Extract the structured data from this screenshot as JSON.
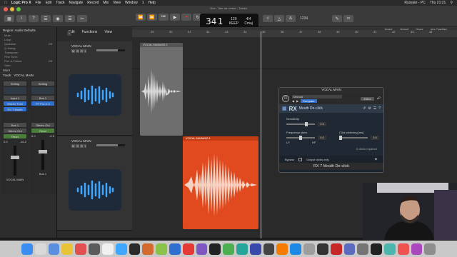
{
  "menubar": {
    "app_name": "Logic Pro X",
    "items": [
      "File",
      "Edit",
      "Track",
      "Navigate",
      "Record",
      "Mix",
      "View",
      "Window",
      "1",
      "Help"
    ],
    "clock": "Thu 21:21",
    "locale": "Russian - PC"
  },
  "window_title": "One - Tate ran verse - Tracks",
  "lcd": {
    "bar": "34",
    "beat": "1",
    "tempo": "120",
    "tempo_label": "KEEP",
    "signature": "4/4",
    "key": "Cmaj"
  },
  "control_right": {
    "value": "1234",
    "snap_label": "Snap:",
    "snap_value": "Smart",
    "drag_label": "Drag:",
    "drag_value": "No Overlap"
  },
  "toolbar": {
    "edit": "Edit",
    "functions": "Functions",
    "view": "View"
  },
  "inspector": {
    "region_header": "Region: Audio Defaults",
    "params": [
      {
        "label": "Mute:",
        "value": ""
      },
      {
        "label": "Loop:",
        "value": ""
      },
      {
        "label": "Quantize:",
        "value": "Off"
      },
      {
        "label": "Q-Swing:",
        "value": ""
      },
      {
        "label": "Transpose:",
        "value": ""
      },
      {
        "label": "Fine Tune:",
        "value": ""
      },
      {
        "label": "Flex & Follow:",
        "value": "Off"
      },
      {
        "label": "Gain:",
        "value": ""
      }
    ],
    "more_label": "More",
    "track_label": "Track:",
    "track_name": "VOCAL MAIN",
    "strip_left": {
      "setting": "Setting",
      "eq": "EQ",
      "input": "Input 1",
      "plugins": [
        "Waves Tune",
        "RX 7 Mouth"
      ],
      "bus": "Bus 1",
      "output": "Stereo Out",
      "mode": "Read",
      "vol": "0.0",
      "pan": "-16.2",
      "name": "VOCAL MAIN"
    },
    "strip_right": {
      "setting": "Setting",
      "eq": "",
      "input": "Bus 1",
      "plugins": [
        "FF Pro-C 2"
      ],
      "bus": "",
      "output": "Stereo Out",
      "mode": "Read",
      "vol": "0.0",
      "pan": "-0.5",
      "name": "Bus 1"
    }
  },
  "tracks": [
    {
      "name": "VOCAL MAIN",
      "m": "M",
      "s": "S",
      "r": "R",
      "i": "I"
    },
    {
      "name": "VOCAL MAIN",
      "m": "M",
      "s": "S",
      "r": "R",
      "i": "I"
    }
  ],
  "ruler_marks": [
    "29",
    "30",
    "31",
    "32",
    "33",
    "34",
    "35",
    "36",
    "37",
    "38",
    "39",
    "40",
    "41",
    "42",
    "43",
    "44"
  ],
  "regions": [
    {
      "name": "VOCAL MAIN#02.2",
      "color": "#6e6e6e"
    },
    {
      "name": "VOCAL MAIN#02.4",
      "color": "#e04a1e"
    }
  ],
  "plugin": {
    "title": "VOCAL MAIN",
    "preset": "Manual",
    "compare": "Compare",
    "editor": "Editor",
    "brand": "RX",
    "module": "Mouth De-click",
    "sensitivity_label": "Sensitivity",
    "sensitivity_value": "2.6",
    "freq_skew_label": "Frequency skew",
    "freq_skew_value": "0.0",
    "lf": "LF",
    "hf": "HF",
    "click_width_label": "Click widening [ms]",
    "click_width_value": "0.0",
    "clicks_repaired": "0 clicks repaired",
    "bypass": "Bypass",
    "output_clicks": "Output clicks only",
    "footer": "RX 7 Mouth De-click"
  },
  "colors": {
    "accent": "#e04a1e",
    "lcd_bg": "#101010",
    "plugin_bg": "#1a2330",
    "record": "#e0332b",
    "blue_button": "#2f6fd0"
  }
}
